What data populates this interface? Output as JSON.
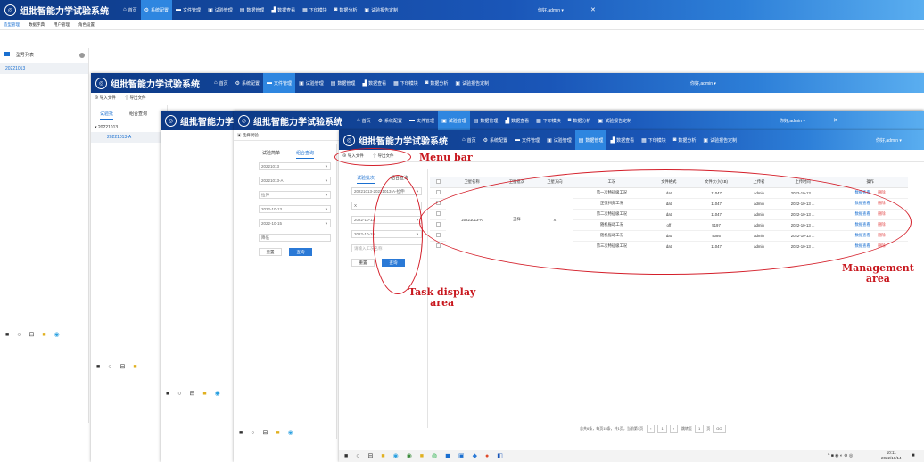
{
  "app": {
    "title": "组批智能力学试验系统",
    "user": "你好,admin ▾",
    "close": "✕"
  },
  "nav": [
    "首页",
    "系统配置",
    "文件管理",
    "试验管理",
    "数据管理",
    "数据查看",
    "下印模块",
    "数据分析",
    "试验报告定制"
  ],
  "nav_icons": [
    "home-icon",
    "gear-icon",
    "folder-icon",
    "flask-icon",
    "table-icon",
    "chart-icon",
    "grid-icon",
    "analysis-icon",
    "report-icon"
  ],
  "w1": {
    "tabs": [
      "造型管理",
      "数据字典",
      "用户管理",
      "角色设置"
    ],
    "side_title": "型号列表",
    "side_item": "20221013"
  },
  "w2": {
    "import": "导入文件",
    "export": "导出文件",
    "ptab1": "试验批",
    "ptab2": "组合查询",
    "tree_root": "20221013",
    "tree_leaf": "20221013-A"
  },
  "w4": {
    "header": "选择试验",
    "ptab1": "试验简单",
    "ptab2": "组合查询",
    "fields": [
      "20221013",
      "20221013-A",
      "拉伸",
      "",
      "2022-10-13",
      "2022-10-15",
      "降低"
    ],
    "reset": "重置",
    "query": "查询"
  },
  "w5": {
    "import": "导入文件",
    "export": "导出文件",
    "ptab1": "试验批次",
    "ptab2": "组合查询",
    "fields": [
      "20221013-20221013-A-拉伸",
      "X",
      "2022-10-13",
      "2022-10-15",
      "请输入工况名称"
    ],
    "reset": "重置",
    "query": "查询",
    "columns": [
      "卫星名称",
      "卫星批次",
      "卫星方向",
      "工况",
      "文件格式",
      "文件大小(KB)",
      "上传者",
      "上传时间",
      "操作"
    ],
    "group": {
      "name": "20221013-A",
      "batch": "正样",
      "dir": "X"
    },
    "rows": [
      {
        "cond": "第一次特征级工况",
        "fmt": "dat",
        "size": "11047",
        "user": "admin",
        "time": "2022-10-13 ..."
      },
      {
        "cond": "正弦扫频工况",
        "fmt": "dat",
        "size": "11047",
        "user": "admin",
        "time": "2022-10-13 ..."
      },
      {
        "cond": "第二次特征级工况",
        "fmt": "dat",
        "size": "11047",
        "user": "admin",
        "time": "2022-10-13 ..."
      },
      {
        "cond": "随机振动工况",
        "fmt": "off",
        "size": "5197",
        "user": "admin",
        "time": "2022-10-13 ..."
      },
      {
        "cond": "随机振动工况",
        "fmt": "dat",
        "size": "4086",
        "user": "admin",
        "time": "2022-10-13 ..."
      },
      {
        "cond": "第三次特征级工况",
        "fmt": "dat",
        "size": "11047",
        "user": "admin",
        "time": "2022-10-13 ..."
      }
    ],
    "op_view": "数据查看",
    "op_del": "删除",
    "pager": {
      "info": "总共6条，每页15条，共1页，当前第1页",
      "page": "1",
      "jump": "跳转至",
      "unit": "页",
      "go": "GO"
    }
  },
  "annotations": {
    "menu": "Menu bar",
    "task": "Task display\narea",
    "mgmt": "Management\narea"
  },
  "tray": {
    "time": "10:11",
    "date": "2022/10/14"
  },
  "colors": {
    "header": "#1a56b8",
    "accent": "#1a6fd0",
    "annotation": "#c8171e"
  }
}
